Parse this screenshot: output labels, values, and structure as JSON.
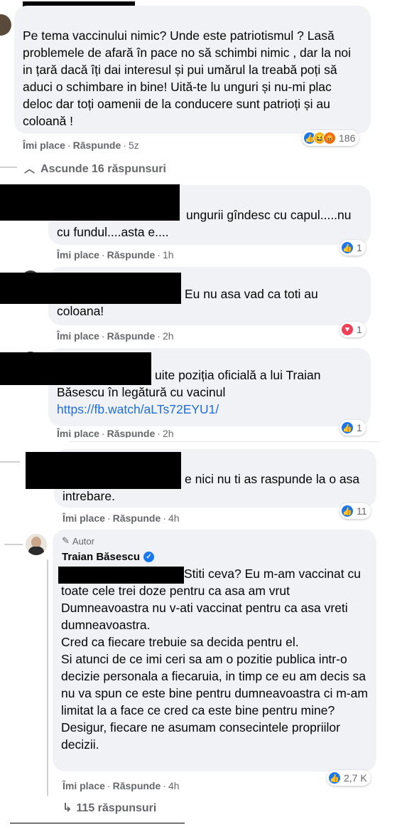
{
  "comments": [
    {
      "text": "Pe tema vaccinului nimic? Unde este patriotismul ? Lasă problemele de afară în pace no să schimbi nimic , dar la noi in țară dacă îți dai interesul și pui umărul la treabă poți să aduci o schimbare in bine! Uită-te lu unguri și nu-mi plac deloc dar toți oamenii de la conducere sunt patrioți și au coloană !",
      "like": "Îmi place",
      "reply": "Răspunde",
      "time": "5z",
      "reactions": [
        "like",
        "haha",
        "angry"
      ],
      "count": "186"
    }
  ],
  "toggle": {
    "label": "Ascunde 16 răspunsuri"
  },
  "replies": [
    {
      "text": "ungurii gîndesc cu capul.....nu cu fundul....asta e....",
      "like": "Îmi place",
      "reply": "Răspunde",
      "time": "1h",
      "reactions": [
        "like"
      ],
      "count": "1"
    },
    {
      "text": "Eu nu asa vad ca toti au coloana!",
      "like": "Îmi place",
      "reply": "Răspunde",
      "time": "2h",
      "reactions": [
        "love"
      ],
      "count": "1"
    },
    {
      "text": "uite poziția oficială a lui Traian Băsescu în legătură cu vacinul",
      "link": "https://fb.watch/aLTs72EYU1/",
      "like": "Îmi place",
      "reply": "Răspunde",
      "time": "2h",
      "reactions": [
        "like"
      ],
      "count": "1"
    },
    {
      "text": "e nici nu ti as raspunde la o asa intrebare.",
      "like": "Îmi place",
      "reply": "Răspunde",
      "time": "4h",
      "reactions": [
        "like"
      ],
      "count": "11"
    }
  ],
  "author_reply": {
    "badge": "Autor",
    "name": "Traian Băsescu",
    "text": "Stiti ceva? Eu m-am vaccinat cu toate cele trei doze pentru ca asa am vrut Dumneavoastra nu v-ati vaccinat pentru ca asa vreti dumneavoastra.\nCred ca fiecare trebuie sa decida pentru el.\nSi atunci de ce imi ceri sa am o pozitie publica intr-o decizie personala a fiecaruia, in timp ce eu am decis sa nu va spun ce este bine pentru dumneavoastra ci m-am limitat la a face ce cred ca este bine pentru mine?\nDesigur, fiecare ne asumam consecintele propriilor decizii.",
    "like": "Îmi place",
    "reply": "Răspunde",
    "time": "4h",
    "reactions": [
      "like"
    ],
    "count": "2,7 K"
  },
  "more_replies": {
    "label": "115 răspunsuri"
  },
  "icons": {
    "toggle": "chevron-up-icon",
    "more": "reply-arrow-icon",
    "author": "pencil-icon",
    "verified": "verified-badge-icon"
  },
  "colors": {
    "accent": "#1877f2",
    "bubble": "#f0f2f5",
    "meta": "#65676b",
    "link": "#216fdb"
  }
}
